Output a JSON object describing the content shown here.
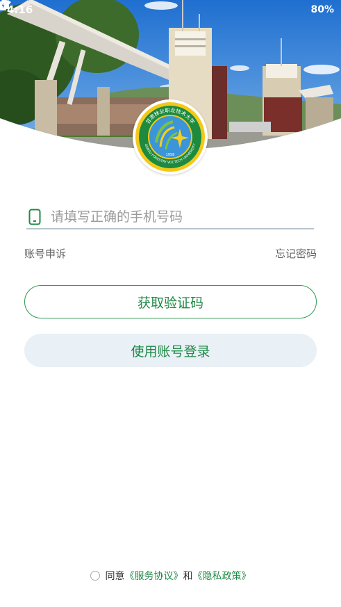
{
  "status_bar": {
    "time": "4:16",
    "battery": "80%",
    "icons": [
      "wifi-icon",
      "signal-icon",
      "battery-icon"
    ]
  },
  "logo": {
    "name": "school-emblem",
    "ring_text": "甘肃林业职业技术大学",
    "ring_text_en": "GANSU FORESTRY VOCTECH UNIVERSITY",
    "year": "1958"
  },
  "login": {
    "phone_placeholder": "请填写正确的手机号码",
    "phone_value": "",
    "account_appeal": "账号申诉",
    "forgot_password": "忘记密码",
    "get_code_button": "获取验证码",
    "account_login_button": "使用账号登录"
  },
  "agreement": {
    "prefix": "同意",
    "service_link": "《服务协议》",
    "conjunction": "和",
    "privacy_link": "《隐私政策》",
    "checked": false
  },
  "colors": {
    "accent_green": "#1e8a45",
    "button_secondary_bg": "#e9f0f6",
    "sky_blue": "#2f7fd6"
  }
}
